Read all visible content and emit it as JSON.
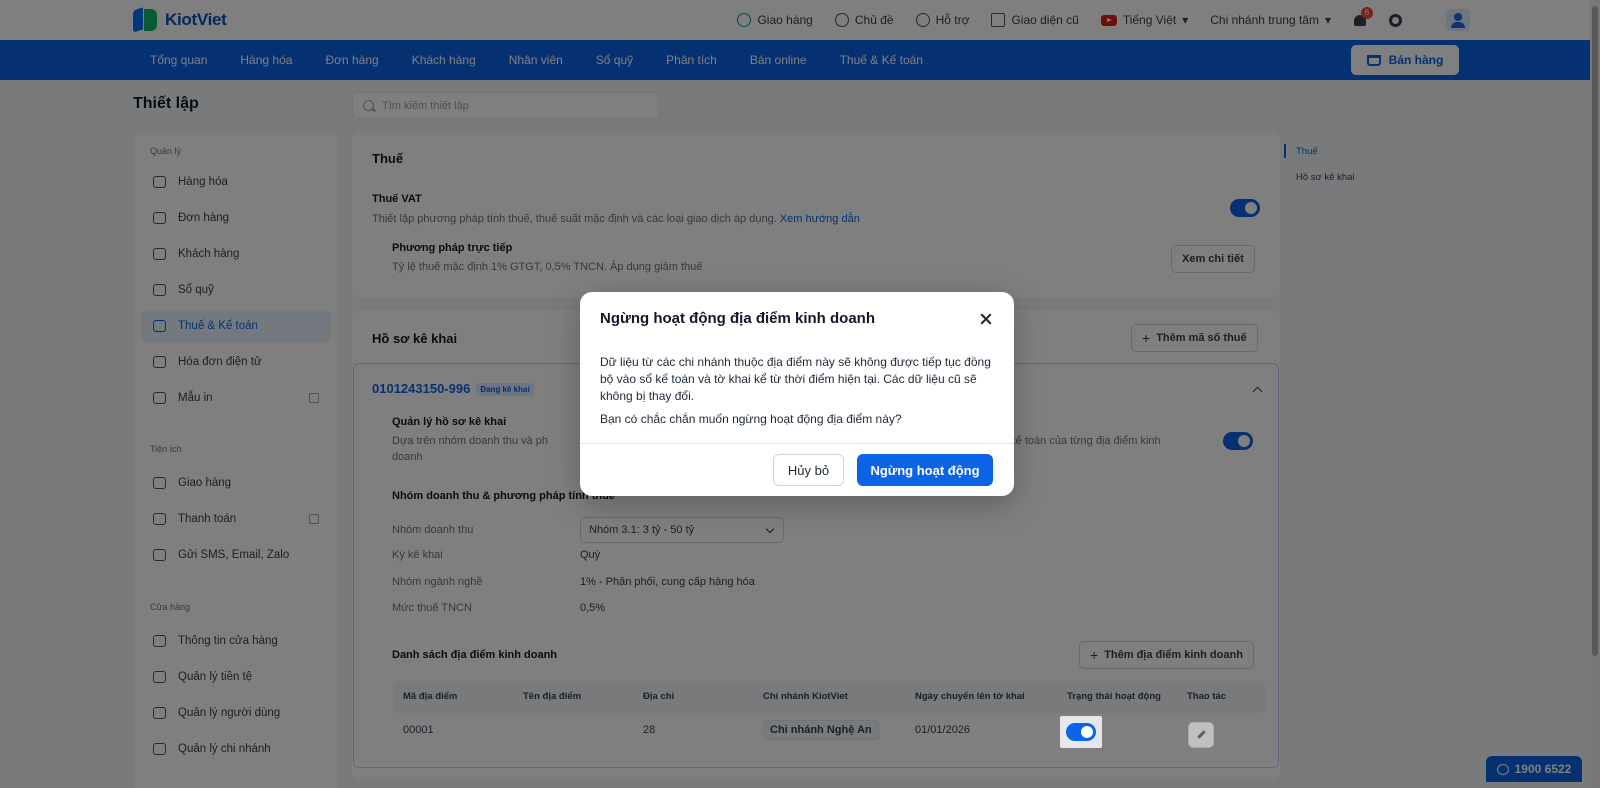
{
  "app": {
    "logo_text": "KiotViet"
  },
  "topbar": {
    "items": [
      "Giao hàng",
      "Chủ đề",
      "Hỗ trợ",
      "Giao diện cũ",
      "Tiếng Việt",
      "Chi nhánh trung tâm"
    ],
    "notification_count": "6"
  },
  "nav": {
    "items": [
      "Tổng quan",
      "Hàng hóa",
      "Đơn hàng",
      "Khách hàng",
      "Nhân viên",
      "Sổ quỹ",
      "Phân tích",
      "Bán online",
      "Thuế & Kế toán"
    ],
    "sell_label": "Bán hàng"
  },
  "page": {
    "title": "Thiết lập",
    "search_placeholder": "Tìm kiếm thiết lập"
  },
  "sidebar": {
    "groups": [
      "Quản lý",
      "Tiện ích",
      "Cửa hàng"
    ],
    "items": [
      "Hàng hóa",
      "Đơn hàng",
      "Khách hàng",
      "Sổ quỹ",
      "Thuế & Kế toán",
      "Hóa đơn điện tử",
      "Mẫu in",
      "Giao hàng",
      "Thanh toán",
      "Gửi SMS, Email, Zalo",
      "Thông tin cửa hàng",
      "Quản lý tiền tệ",
      "Quản lý người dùng",
      "Quản lý chi nhánh"
    ],
    "active_index": 4
  },
  "tax": {
    "title": "Thuế",
    "vat_title": "Thuế VAT",
    "vat_desc": "Thiết lập phương pháp tính thuế, thuế suất mặc định và các loại giao dịch áp dụng.",
    "vat_link": "Xem hướng dẫn",
    "method_title": "Phương pháp trực tiếp",
    "method_desc": "Tỷ lệ thuế mặc định 1% GTGT, 0,5% TNCN. Áp dụng giảm thuế",
    "detail_button": "Xem chi tiết"
  },
  "filing": {
    "title": "Hồ sơ kê khai",
    "add_tax_button": "Thêm mã số thuế",
    "tax_code": "0101243150-996",
    "tax_code_tag": "Đang kê khai",
    "manage_title": "Quản lý hồ sơ kê khai",
    "manage_desc_a": "Dựa trên nhóm doanh thu và ph",
    "manage_desc_b": "doanh",
    "manage_desc_c": "ổ kế toán của từng địa điểm kinh",
    "group_section": "Nhóm doanh thu & phương pháp tính thuế",
    "fields": [
      {
        "label": "Nhóm doanh thu",
        "value": "Nhóm 3.1: 3 tỷ - 50 tỷ"
      },
      {
        "label": "Kỳ kê khai",
        "value": "Quý"
      },
      {
        "label": "Nhóm ngành nghề",
        "value": "1% - Phân phối, cung cấp hàng hóa"
      },
      {
        "label": "Mức thuế TNCN",
        "value": "0,5%"
      }
    ],
    "locations_title": "Danh sách địa điểm kinh doanh",
    "add_location_button": "Thêm địa điểm kinh doanh",
    "table": {
      "columns": [
        "Mã địa điểm",
        "Tên địa điểm",
        "Địa chỉ",
        "Chi nhánh KiotViet",
        "Ngày chuyển lên tờ khai",
        "Trạng thái hoạt động",
        "Thao tác"
      ],
      "rows": [
        {
          "code": "00001",
          "name": "",
          "address": "28",
          "branch": "Chi nhánh Nghệ An",
          "date": "01/01/2026"
        }
      ]
    }
  },
  "anchor_nav": {
    "items": [
      "Thuế",
      "Hồ sơ kê khai"
    ]
  },
  "hotline": "1900 6522",
  "modal": {
    "title": "Ngừng hoạt động địa điểm kinh doanh",
    "body": "Dữ liệu từ các chi nhánh thuộc địa điểm này sẽ không được tiếp tục đồng bộ vào sổ kế toán và tờ khai kể từ thời điểm hiện tại. Các dữ liệu cũ sẽ không bị thay đổi.",
    "question": "Bạn có chắc chắn muốn ngừng hoạt động địa điểm này?",
    "cancel_label": "Hủy bỏ",
    "confirm_label": "Ngừng hoạt động"
  }
}
